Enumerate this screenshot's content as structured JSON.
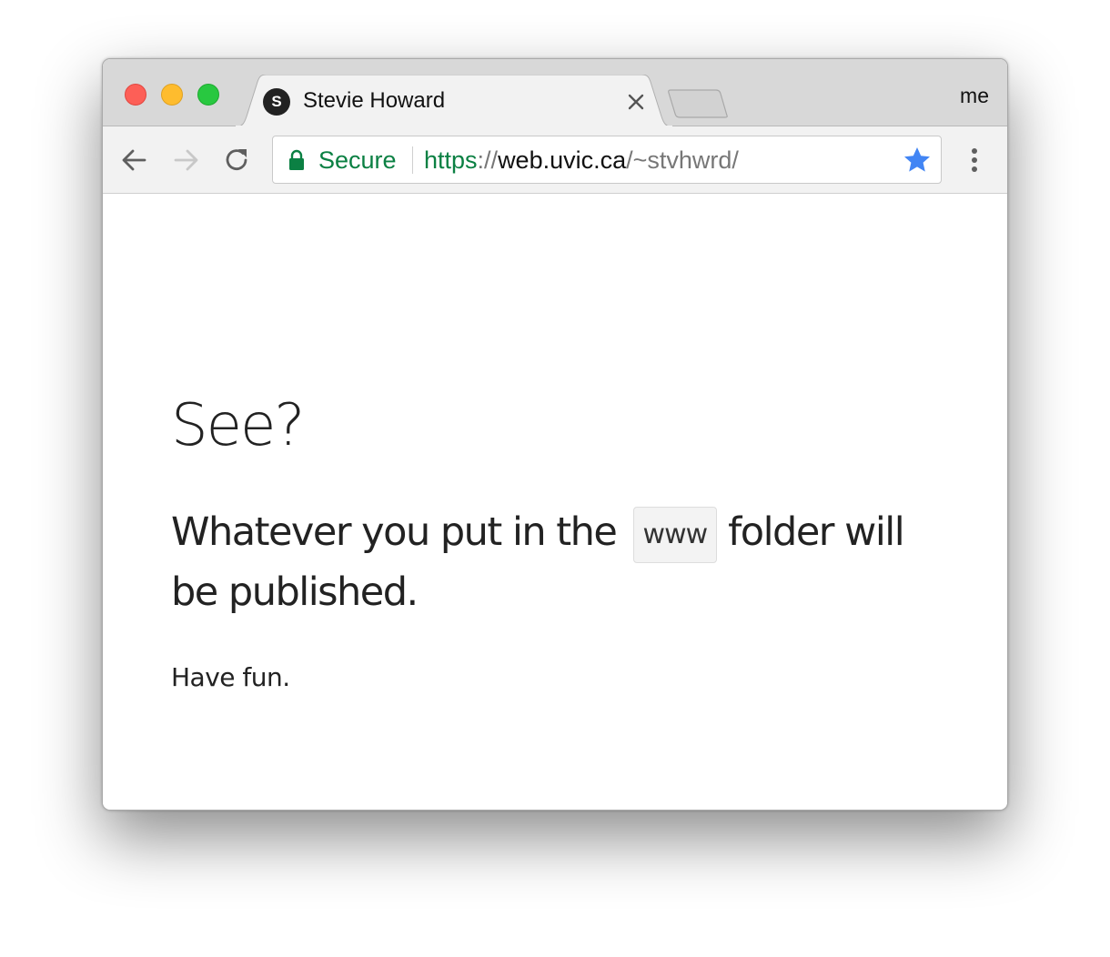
{
  "browser": {
    "tab": {
      "favicon_letter": "S",
      "title": "Stevie Howard"
    },
    "profile_label": "me",
    "address_bar": {
      "security_label": "Secure",
      "url_scheme": "https",
      "url_separator": "://",
      "url_host": "web.uvic.ca",
      "url_path": "/~stvhwrd/"
    },
    "icons": {
      "back": "arrow-left-icon",
      "forward": "arrow-right-icon",
      "reload": "reload-icon",
      "lock": "lock-icon",
      "bookmark": "star-icon",
      "menu": "kebab-menu-icon",
      "tab_close": "close-icon"
    },
    "colors": {
      "secure_green": "#0b8043",
      "bookmark_blue": "#4285f4",
      "close_red": "#fd5f57",
      "minimize_yellow": "#febc2e",
      "maximize_green": "#28c840"
    }
  },
  "page": {
    "heading": "See?",
    "lead_before": "Whatever you put in the",
    "lead_code": "www",
    "lead_after": "folder will be published.",
    "closing": "Have fun."
  }
}
